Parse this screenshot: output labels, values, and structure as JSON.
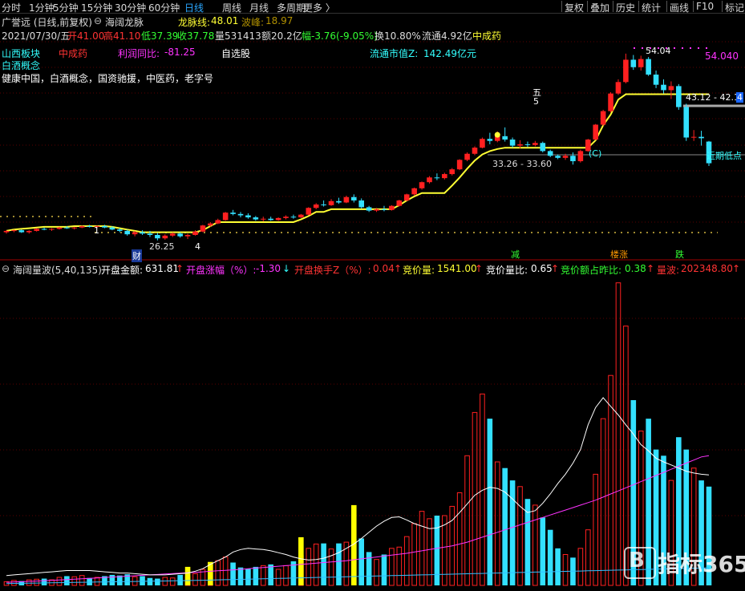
{
  "toolbar": {
    "tabs": [
      "分时",
      "1分钟",
      "5分钟",
      "15分钟",
      "30分钟",
      "60分钟",
      "日线",
      "周线",
      "月线",
      "多周期",
      "更多 〉"
    ],
    "active_tab": "日线",
    "right_tabs": [
      "复权",
      "叠加",
      "历史",
      "统计",
      "画线",
      "F10",
      "标记"
    ]
  },
  "header": {
    "stock_name": "广誉远 (日线,前复权)",
    "indicator_name": "海阔龙脉",
    "longmai_label": "龙脉线:",
    "longmai_value": "48.01",
    "wave_label": "波峰:",
    "wave_value": "18.97",
    "quote_date": "2021/07/30/五",
    "open": "开41.00",
    "high": "高41.10",
    "low": "低37.39",
    "close": "收37.78",
    "volume": "量531413",
    "amount": "额20.2亿",
    "change": "幅-3.76(-9.05%)",
    "turnover": "换10.80%",
    "float": "流通4.92亿",
    "industry": "中成药"
  },
  "info": {
    "sector": "山西板块",
    "industry": "中成药",
    "profit_label": "利润同比:",
    "profit_value": "-81.25",
    "watch": "自选股",
    "mktcap_label": "流通市值Z:",
    "mktcap_value": "142.49亿元",
    "concept": "白酒概念",
    "concepts": "健康中国，白酒概念，国资驰援，中医药，老字号"
  },
  "price_annotations": {
    "high_label": "54.040",
    "peak_label": "54.04",
    "zone_upper": "43.12 - 42.1",
    "zone_right_marker": "4",
    "zone_lower": "33.26 - 33.60",
    "recent_low": "近期低点",
    "low_label": "26.25",
    "five_cn": "五",
    "five_num": "5",
    "c_mark": "(C)",
    "mark_1": "1",
    "mark_4": "4",
    "cai": "财",
    "jian": "减",
    "lou_zhang": "楼涨",
    "die": "跌"
  },
  "volume_header": {
    "title": "海阔量波(5,40,135)",
    "open_amount_label": "开盘金额:",
    "open_amount": "631.81",
    "open_change_label": "开盘涨幅（%）:",
    "open_change": "-1.30",
    "open_turnover_label": "开盘换手Z（%）:",
    "open_turnover": "0.04",
    "auction_vol_label": "竞价量:",
    "auction_vol": "1541.00",
    "auction_ratio_label": "竞价量比:",
    "auction_ratio": "0.65",
    "auction_amt_label": "竞价额占昨比:",
    "auction_amt": "0.38",
    "wave_label": "量波:",
    "wave": "202348.80"
  },
  "watermark": "指标365",
  "colors": {
    "up": "#ff2020",
    "down": "#33e0ff",
    "line_yellow": "#ffff33",
    "magenta": "#ff33ff",
    "auction_yellow": "#ffff00"
  },
  "chart_data": {
    "type": "candlestick",
    "price_range": [
      24,
      56
    ],
    "candles": [
      [
        27.6,
        27.9,
        27.4,
        27.8
      ],
      [
        27.8,
        28.0,
        27.6,
        27.9
      ],
      [
        27.9,
        28.0,
        27.5,
        27.6
      ],
      [
        27.6,
        27.9,
        27.4,
        27.8
      ],
      [
        27.8,
        28.2,
        27.7,
        28.1
      ],
      [
        28.1,
        28.3,
        27.9,
        28.0
      ],
      [
        28.0,
        28.2,
        27.8,
        28.1
      ],
      [
        28.1,
        28.4,
        28.0,
        28.3
      ],
      [
        28.3,
        28.5,
        28.1,
        28.2
      ],
      [
        28.2,
        28.4,
        28.0,
        28.3
      ],
      [
        28.3,
        28.6,
        28.2,
        28.5
      ],
      [
        28.5,
        28.7,
        28.3,
        28.4
      ],
      [
        28.4,
        28.6,
        28.2,
        28.5
      ],
      [
        28.5,
        28.7,
        28.2,
        28.3
      ],
      [
        28.3,
        28.5,
        27.9,
        28.0
      ],
      [
        28.0,
        28.2,
        27.6,
        27.8
      ],
      [
        27.8,
        28.0,
        27.1,
        27.3
      ],
      [
        27.3,
        27.8,
        27.0,
        27.6
      ],
      [
        27.6,
        27.9,
        27.2,
        27.4
      ],
      [
        27.4,
        27.8,
        26.9,
        27.2
      ],
      [
        27.2,
        27.5,
        26.4,
        26.7
      ],
      [
        26.7,
        27.3,
        26.5,
        27.1
      ],
      [
        27.1,
        27.6,
        26.9,
        27.4
      ],
      [
        27.4,
        27.6,
        26.8,
        27.0
      ],
      [
        27.0,
        27.4,
        26.6,
        27.2
      ],
      [
        27.2,
        27.9,
        27.1,
        27.7
      ],
      [
        27.7,
        28.7,
        27.6,
        28.6
      ],
      [
        28.6,
        29.1,
        28.4,
        28.9
      ],
      [
        28.9,
        29.6,
        28.8,
        29.4
      ],
      [
        29.4,
        30.6,
        29.3,
        30.5
      ],
      [
        30.5,
        30.9,
        30.1,
        30.3
      ],
      [
        30.3,
        30.6,
        29.8,
        30.1
      ],
      [
        30.1,
        30.4,
        29.6,
        29.8
      ],
      [
        29.8,
        30.0,
        29.3,
        29.5
      ],
      [
        29.5,
        29.9,
        29.2,
        29.6
      ],
      [
        29.6,
        29.9,
        29.3,
        29.4
      ],
      [
        29.4,
        29.8,
        29.3,
        29.7
      ],
      [
        29.7,
        30.1,
        29.5,
        29.9
      ],
      [
        29.9,
        30.2,
        29.6,
        29.8
      ],
      [
        29.8,
        30.3,
        29.7,
        30.2
      ],
      [
        30.2,
        31.3,
        30.1,
        31.2
      ],
      [
        31.2,
        31.9,
        31.0,
        31.7
      ],
      [
        31.7,
        32.3,
        31.4,
        31.6
      ],
      [
        31.6,
        32.5,
        31.5,
        32.2
      ],
      [
        32.2,
        32.7,
        31.8,
        32.0
      ],
      [
        32.0,
        33.0,
        31.9,
        32.8
      ],
      [
        32.8,
        33.2,
        32.0,
        32.3
      ],
      [
        32.3,
        32.6,
        31.1,
        31.3
      ],
      [
        31.3,
        31.5,
        30.6,
        30.8
      ],
      [
        30.8,
        31.2,
        30.6,
        31.0
      ],
      [
        31.0,
        31.5,
        30.7,
        30.9
      ],
      [
        30.9,
        31.6,
        30.8,
        31.5
      ],
      [
        31.5,
        32.4,
        31.4,
        32.3
      ],
      [
        32.3,
        33.3,
        32.2,
        33.2
      ],
      [
        33.2,
        34.2,
        33.0,
        34.1
      ],
      [
        34.1,
        35.1,
        33.9,
        35.0
      ],
      [
        35.0,
        35.9,
        34.8,
        35.7
      ],
      [
        35.7,
        36.3,
        35.3,
        35.6
      ],
      [
        35.6,
        36.4,
        35.4,
        36.2
      ],
      [
        36.2,
        37.1,
        36.0,
        36.9
      ],
      [
        36.9,
        38.4,
        36.8,
        38.3
      ],
      [
        38.3,
        39.4,
        38.1,
        39.2
      ],
      [
        39.2,
        40.3,
        39.0,
        40.1
      ],
      [
        40.1,
        41.6,
        40.0,
        41.4
      ],
      [
        41.4,
        42.3,
        40.6,
        41.1
      ],
      [
        41.1,
        42.5,
        40.9,
        41.8
      ],
      [
        41.8,
        43.1,
        41.0,
        41.3
      ],
      [
        41.3,
        41.6,
        40.1,
        40.4
      ],
      [
        40.4,
        41.2,
        40.0,
        40.6
      ],
      [
        40.6,
        41.0,
        40.2,
        40.5
      ],
      [
        40.5,
        41.1,
        40.3,
        40.8
      ],
      [
        40.8,
        41.0,
        39.4,
        39.6
      ],
      [
        39.6,
        39.8,
        38.7,
        38.9
      ],
      [
        38.9,
        39.1,
        38.4,
        38.6
      ],
      [
        38.6,
        39.2,
        38.3,
        38.9
      ],
      [
        38.9,
        39.4,
        37.6,
        38.1
      ],
      [
        38.1,
        39.8,
        37.9,
        39.6
      ],
      [
        39.6,
        41.4,
        39.5,
        41.3
      ],
      [
        41.3,
        43.6,
        41.2,
        43.5
      ],
      [
        43.5,
        45.7,
        43.3,
        45.5
      ],
      [
        45.5,
        48.3,
        45.3,
        48.1
      ],
      [
        48.1,
        50.2,
        47.9,
        49.8
      ],
      [
        49.8,
        54.0,
        49.6,
        53.1
      ],
      [
        53.1,
        53.8,
        51.6,
        52.0
      ],
      [
        52.0,
        53.7,
        51.5,
        53.2
      ],
      [
        53.2,
        53.5,
        50.7,
        50.9
      ],
      [
        50.9,
        51.5,
        48.9,
        49.4
      ],
      [
        49.4,
        50.2,
        48.1,
        48.6
      ],
      [
        48.6,
        49.9,
        47.3,
        49.2
      ],
      [
        49.2,
        49.5,
        45.7,
        46.1
      ],
      [
        46.1,
        46.6,
        41.1,
        41.6
      ],
      [
        41.6,
        42.7,
        41.1,
        41.7
      ],
      [
        41.7,
        42.6,
        40.4,
        41.5
      ],
      [
        41.0,
        41.1,
        37.4,
        37.8
      ]
    ],
    "longmai_line": [
      27.8,
      28.0,
      28.1,
      28.2,
      28.3,
      28.4,
      28.4,
      28.4,
      28.4,
      28.5,
      28.5,
      28.5,
      28.5,
      28.5,
      28.4,
      28.2,
      28.0,
      27.8,
      27.6,
      27.6,
      27.6,
      27.6,
      27.6,
      27.6,
      27.6,
      27.6,
      27.9,
      28.5,
      29.1,
      29.1,
      29.1,
      29.1,
      29.1,
      29.1,
      29.1,
      29.1,
      29.1,
      29.1,
      29.1,
      29.5,
      30.0,
      30.6,
      30.6,
      31.0,
      31.0,
      31.0,
      31.0,
      31.0,
      31.0,
      31.0,
      31.0,
      31.0,
      31.6,
      32.3,
      32.9,
      33.4,
      33.4,
      33.4,
      33.4,
      34.5,
      35.7,
      37.0,
      38.2,
      39.1,
      39.6,
      39.9,
      40.1,
      40.1,
      40.1,
      40.1,
      40.1,
      40.1,
      40.1,
      40.1,
      40.1,
      40.1,
      40.1,
      40.1,
      41.2,
      43.4,
      45.0,
      47.2,
      48.0,
      48.0,
      48.0,
      48.0,
      48.0,
      48.0,
      48.0,
      48.0,
      48.0,
      48.0,
      48.0,
      48.0
    ],
    "volume_range": [
      0,
      50000
    ],
    "volume": [
      600,
      800,
      700,
      900,
      1000,
      1100,
      900,
      1300,
      1500,
      1400,
      1600,
      1200,
      1300,
      1500,
      1700,
      1600,
      1800,
      1400,
      1500,
      1200,
      1100,
      1300,
      1200,
      1700,
      1400,
      1900,
      2600,
      3500,
      4000,
      4600,
      3700,
      2900,
      2700,
      3000,
      3200,
      3400,
      2600,
      3200,
      3900,
      4800,
      6000,
      6700,
      6800,
      5900,
      6800,
      7000,
      7500,
      7600,
      5400,
      4200,
      5000,
      6000,
      6200,
      7900,
      10000,
      12000,
      10800,
      11300,
      11300,
      12800,
      15000,
      21000,
      28000,
      31000,
      27000,
      20000,
      19000,
      17000,
      16000,
      14000,
      13000,
      11000,
      9000,
      6000,
      5000,
      4500,
      6000,
      9000,
      18000,
      27000,
      34000,
      49000,
      42000,
      30000,
      25000,
      27000,
      22000,
      21000,
      17000,
      24000,
      22000,
      19000,
      17000,
      16000
    ],
    "auction": [
      200,
      250,
      300,
      280,
      260,
      240,
      260,
      300,
      320,
      310,
      300,
      280,
      260,
      240,
      230,
      250,
      300,
      320,
      340,
      400,
      450,
      500,
      480,
      520,
      560,
      600,
      550,
      500,
      480,
      520,
      600,
      560,
      520,
      500,
      480,
      460,
      520,
      600,
      620,
      600,
      650,
      700,
      680,
      720,
      700,
      760,
      780,
      740,
      700,
      680,
      720,
      760,
      800,
      860,
      900,
      960,
      1000,
      1100,
      1200,
      1800,
      8700,
      7600,
      6000,
      5500,
      4800,
      4200,
      3800,
      3300,
      2800,
      2400,
      2000,
      1800,
      1600,
      1400,
      1200,
      1100,
      1000,
      1800,
      3800,
      6200,
      8000,
      10500,
      12300,
      11000,
      9400,
      9000,
      7500,
      7400,
      7800,
      6800,
      7200,
      7000,
      6800,
      6600
    ],
    "ma_white": [
      1600,
      1700,
      1800,
      1900,
      2000,
      2100,
      2200,
      2300,
      2400,
      2400,
      2400,
      2400,
      2300,
      2200,
      2100,
      2000,
      2000,
      1900,
      1800,
      1700,
      1700,
      1700,
      1800,
      1900,
      2000,
      2300,
      2700,
      3400,
      4000,
      4600,
      5400,
      5800,
      6000,
      5900,
      5800,
      5600,
      5300,
      5000,
      4600,
      4300,
      4100,
      4200,
      4400,
      4800,
      5300,
      6000,
      6700,
      7600,
      8600,
      9600,
      10400,
      11000,
      11100,
      10600,
      10000,
      9600,
      9200,
      9300,
      9800,
      10500,
      11800,
      13200,
      14600,
      15400,
      15900,
      15700,
      15100,
      14000,
      12800,
      11800,
      12100,
      13300,
      14800,
      16500,
      18000,
      19800,
      22000,
      26000,
      28800,
      30400,
      29000,
      27600,
      26000,
      24500,
      22800,
      21800,
      20600,
      20000,
      19500,
      19000,
      18500,
      18200,
      18000,
      17900
    ],
    "ma_magenta": [
      500,
      550,
      600,
      650,
      700,
      760,
      820,
      880,
      940,
      1000,
      1070,
      1140,
      1210,
      1280,
      1350,
      1420,
      1490,
      1560,
      1630,
      1700,
      1770,
      1840,
      1910,
      1980,
      2050,
      2120,
      2200,
      2280,
      2360,
      2440,
      2520,
      2600,
      2700,
      2800,
      2900,
      3000,
      3100,
      3200,
      3300,
      3400,
      3500,
      3600,
      3700,
      3800,
      3900,
      4000,
      4150,
      4300,
      4450,
      4600,
      4750,
      4900,
      5050,
      5200,
      5400,
      5600,
      5800,
      6000,
      6200,
      6400,
      6700,
      7000,
      7400,
      7800,
      8200,
      8600,
      9000,
      9400,
      9800,
      10200,
      10600,
      11000,
      11400,
      11800,
      12200,
      12600,
      13000,
      13400,
      13800,
      14300,
      14800,
      15300,
      15800,
      16300,
      16800,
      17300,
      17800,
      18300,
      18800,
      19300,
      19800,
      20300,
      20800,
      21000
    ],
    "ma_cyan": [
      300,
      320,
      340,
      360,
      380,
      400,
      420,
      440,
      460,
      480,
      500,
      520,
      540,
      560,
      580,
      600,
      620,
      640,
      660,
      680,
      700,
      720,
      740,
      760,
      780,
      800,
      830,
      860,
      890,
      920,
      950,
      980,
      1010,
      1040,
      1070,
      1100,
      1130,
      1160,
      1190,
      1220,
      1250,
      1280,
      1310,
      1340,
      1370,
      1400,
      1430,
      1460,
      1490,
      1520,
      1550,
      1580,
      1610,
      1640,
      1670,
      1700,
      1730,
      1760,
      1790,
      1820,
      1850,
      1880,
      1910,
      1940,
      1970,
      2000,
      2030,
      2060,
      2090,
      2120,
      2150,
      2180,
      2210,
      2240,
      2270,
      2300,
      2330,
      2360,
      2390,
      2420,
      2450,
      2480,
      2510,
      2540,
      2570,
      2600,
      2630,
      2660,
      2690,
      2720,
      2750,
      2780,
      2810,
      2840
    ]
  }
}
